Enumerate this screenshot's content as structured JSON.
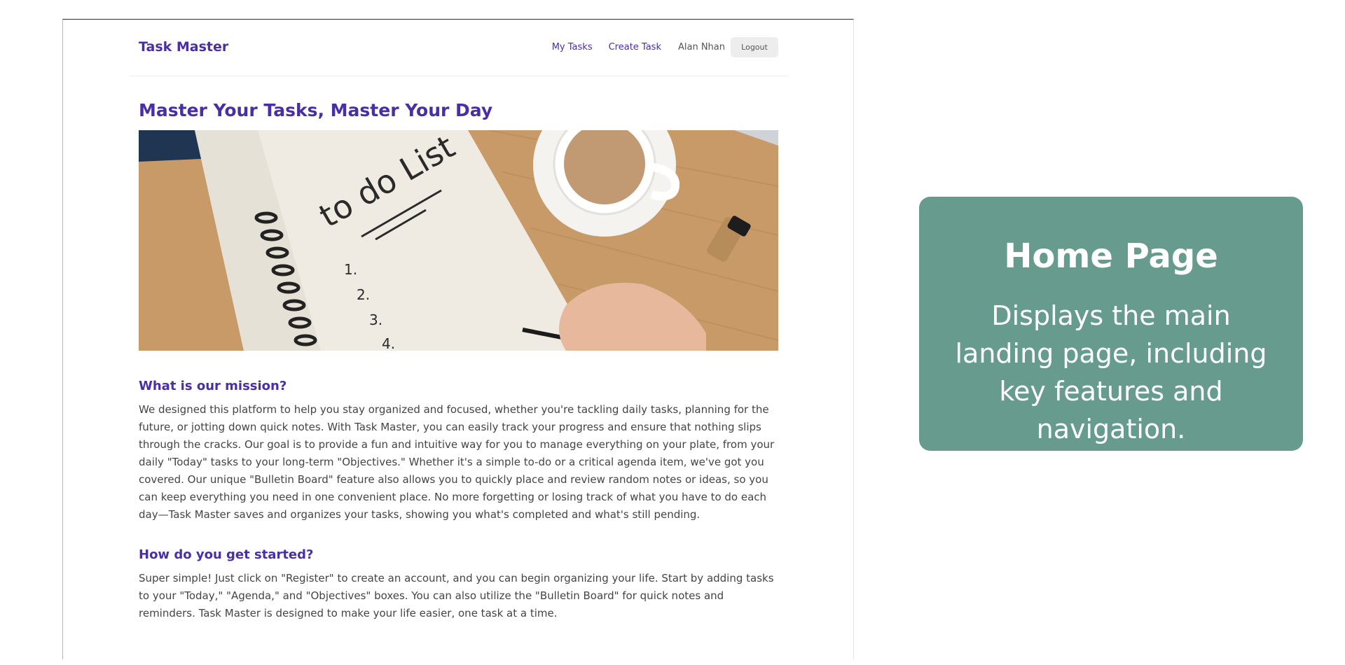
{
  "navbar": {
    "brand": "Task Master",
    "links": [
      "My Tasks",
      "Create Task"
    ],
    "user": "Alan Nhan",
    "logout_label": "Logout"
  },
  "hero": {
    "title": "Master Your Tasks, Master Your Day",
    "image_text": "to do List",
    "image_items": [
      "1.",
      "2.",
      "3.",
      "4."
    ]
  },
  "mission": {
    "title": "What is our mission?",
    "body": "We designed this platform to help you stay organized and focused, whether you're tackling daily tasks, planning for the future, or jotting down quick notes. With Task Master, you can easily track your progress and ensure that nothing slips through the cracks. Our goal is to provide a fun and intuitive way for you to manage everything on your plate, from your daily \"Today\" tasks to your long-term \"Objectives.\" Whether it's a simple to-do or a critical agenda item, we've got you covered. Our unique \"Bulletin Board\" feature also allows you to quickly place and review random notes or ideas, so you can keep everything you need in one convenient place. No more forgetting or losing track of what you have to do each day—Task Master saves and organizes your tasks, showing you what's completed and what's still pending."
  },
  "started": {
    "title": "How do you get started?",
    "body": "Super simple! Just click on \"Register\" to create an account, and you can begin organizing your life. Start by adding tasks to your \"Today,\" \"Agenda,\" and \"Objectives\" boxes. You can also utilize the \"Bulletin Board\" for quick notes and reminders. Task Master is designed to make your life easier, one task at a time."
  },
  "card": {
    "title": "Home Page",
    "description": "Displays the main landing page, including key features and navigation.",
    "color": "#669b8e"
  },
  "colors": {
    "accent": "#4a2ea6"
  }
}
